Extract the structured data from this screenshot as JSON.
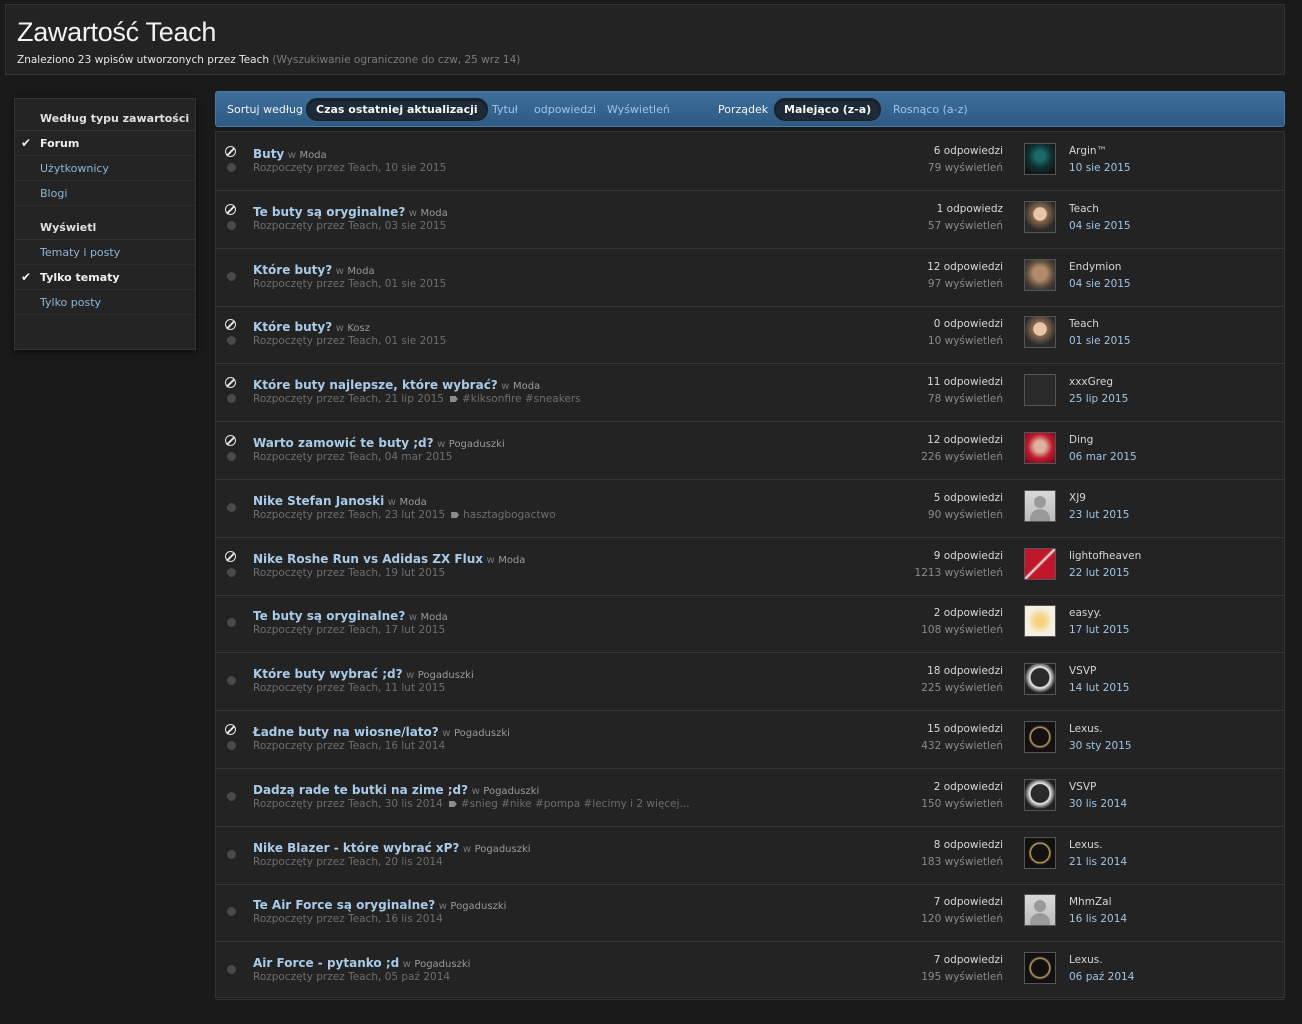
{
  "header": {
    "title": "Zawartość Teach",
    "summary": "Znaleziono 23 wpisów utworzonych przez Teach",
    "limit_note": "(Wyszukiwanie ograniczone do czw, 25 wrz 14)"
  },
  "sidebar": {
    "group1_title": "Według typu zawartości",
    "group1_items": [
      {
        "label": "Forum",
        "active": true
      },
      {
        "label": "Użytkownicy",
        "active": false
      },
      {
        "label": "Blogi",
        "active": false
      }
    ],
    "group2_title": "Wyświetl",
    "group2_items": [
      {
        "label": "Tematy i posty",
        "active": false
      },
      {
        "label": "Tylko tematy",
        "active": true
      },
      {
        "label": "Tylko posty",
        "active": false
      }
    ]
  },
  "sortbar": {
    "sort_label": "Sortuj według",
    "sort_active": "Czas ostatniej aktualizacji",
    "sort_opt1": "Tytuł",
    "sort_opt2": "odpowiedzi",
    "sort_opt3": "Wyświetleń",
    "order_label": "Porządek",
    "order_active": "Malejąco (z-a)",
    "order_opt": "Rosnąco (a-z)"
  },
  "topics": [
    {
      "title": "Buty",
      "in": "w",
      "forum": "Moda",
      "meta": "Rozpoczęty przez Teach, 10 sie 2015",
      "tags": "",
      "locked": true,
      "replies": "6 odpowiedzi",
      "views": "79 wyświetleń",
      "last_user": "Argin™",
      "last_date": "10 sie 2015",
      "avatar": "argin"
    },
    {
      "title": "Te buty są oryginalne?",
      "in": "w",
      "forum": "Moda",
      "meta": "Rozpoczęty przez Teach, 03 sie 2015",
      "tags": "",
      "locked": true,
      "replies": "1 odpowiedz",
      "views": "57 wyświetleń",
      "last_user": "Teach",
      "last_date": "04 sie 2015",
      "avatar": "photo1"
    },
    {
      "title": "Które buty?",
      "in": "w",
      "forum": "Moda",
      "meta": "Rozpoczęty przez Teach, 01 sie 2015",
      "tags": "",
      "locked": false,
      "replies": "12 odpowiedzi",
      "views": "97 wyświetleń",
      "last_user": "Endymion",
      "last_date": "04 sie 2015",
      "avatar": "photo2"
    },
    {
      "title": "Które buty?",
      "in": "w",
      "forum": "Kosz",
      "meta": "Rozpoczęty przez Teach, 01 sie 2015",
      "tags": "",
      "locked": true,
      "replies": "0 odpowiedzi",
      "views": "10 wyświetleń",
      "last_user": "Teach",
      "last_date": "01 sie 2015",
      "avatar": "photo1"
    },
    {
      "title": "Które buty najlepsze, które wybrać?",
      "in": "w",
      "forum": "Moda",
      "meta": "Rozpoczęty przez Teach, 21 lip 2015",
      "tags": "#kiksonfire #sneakers",
      "locked": true,
      "replies": "11 odpowiedzi",
      "views": "78 wyświetleń",
      "last_user": "xxxGreg",
      "last_date": "25 lip 2015",
      "avatar": "dark"
    },
    {
      "title": "Warto zamowić te buty ;d?",
      "in": "w",
      "forum": "Pogaduszki",
      "meta": "Rozpoczęty przez Teach, 04 mar 2015",
      "tags": "",
      "locked": true,
      "replies": "12 odpowiedzi",
      "views": "226 wyświetleń",
      "last_user": "Ding",
      "last_date": "06 mar 2015",
      "avatar": "red"
    },
    {
      "title": "Nike Stefan Janoski",
      "in": "w",
      "forum": "Moda",
      "meta": "Rozpoczęty przez Teach, 23 lut 2015",
      "tags": "hasztagbogactwo",
      "locked": false,
      "replies": "5 odpowiedzi",
      "views": "90 wyświetleń",
      "last_user": "XJ9",
      "last_date": "23 lut 2015",
      "avatar": "grey"
    },
    {
      "title": "Nike Roshe Run vs Adidas ZX Flux",
      "in": "w",
      "forum": "Moda",
      "meta": "Rozpoczęty przez Teach, 19 lut 2015",
      "tags": "",
      "locked": true,
      "replies": "9 odpowiedzi",
      "views": "1213 wyświetleń",
      "last_user": "lightofheaven",
      "last_date": "22 lut 2015",
      "avatar": "jp"
    },
    {
      "title": "Te buty są oryginalne?",
      "in": "w",
      "forum": "Moda",
      "meta": "Rozpoczęty przez Teach, 17 lut 2015",
      "tags": "",
      "locked": false,
      "replies": "2 odpowiedzi",
      "views": "108 wyświetleń",
      "last_user": "easyy.",
      "last_date": "17 lut 2015",
      "avatar": "sunny"
    },
    {
      "title": "Które buty wybrać ;d?",
      "in": "w",
      "forum": "Pogaduszki",
      "meta": "Rozpoczęty przez Teach, 11 lut 2015",
      "tags": "",
      "locked": false,
      "replies": "18 odpowiedzi",
      "views": "225 wyświetleń",
      "last_user": "VSVP",
      "last_date": "14 lut 2015",
      "avatar": "face"
    },
    {
      "title": "Ładne buty na wiosne/lato?",
      "in": "w",
      "forum": "Pogaduszki",
      "meta": "Rozpoczęty przez Teach, 16 lut 2014",
      "tags": "",
      "locked": true,
      "replies": "15 odpowiedzi",
      "views": "432 wyświetleń",
      "last_user": "Lexus.",
      "last_date": "30 sty 2015",
      "avatar": "logo"
    },
    {
      "title": "Dadzą rade te butki na zime ;d?",
      "in": "w",
      "forum": "Pogaduszki",
      "meta": "Rozpoczęty przez Teach, 30 lis 2014",
      "tags": "#snieg #nike #pompa #lecimy i 2 więcej...",
      "locked": false,
      "replies": "2 odpowiedzi",
      "views": "150 wyświetleń",
      "last_user": "VSVP",
      "last_date": "30 lis 2014",
      "avatar": "face"
    },
    {
      "title": "Nike Blazer - które wybrać xP?",
      "in": "w",
      "forum": "Pogaduszki",
      "meta": "Rozpoczęty przez Teach, 20 lis 2014",
      "tags": "",
      "locked": false,
      "replies": "8 odpowiedzi",
      "views": "183 wyświetleń",
      "last_user": "Lexus.",
      "last_date": "21 lis 2014",
      "avatar": "logo"
    },
    {
      "title": "Te Air Force są oryginalne?",
      "in": "w",
      "forum": "Pogaduszki",
      "meta": "Rozpoczęty przez Teach, 16 lis 2014",
      "tags": "",
      "locked": false,
      "replies": "7 odpowiedzi",
      "views": "120 wyświetleń",
      "last_user": "MhmZal",
      "last_date": "16 lis 2014",
      "avatar": "grey"
    },
    {
      "title": "Air Force - pytanko ;d",
      "in": "w",
      "forum": "Pogaduszki",
      "meta": "Rozpoczęty przez Teach, 05 paź 2014",
      "tags": "",
      "locked": false,
      "replies": "7 odpowiedzi",
      "views": "195 wyświetleń",
      "last_user": "Lexus.",
      "last_date": "06 paź 2014",
      "avatar": "logo"
    }
  ]
}
